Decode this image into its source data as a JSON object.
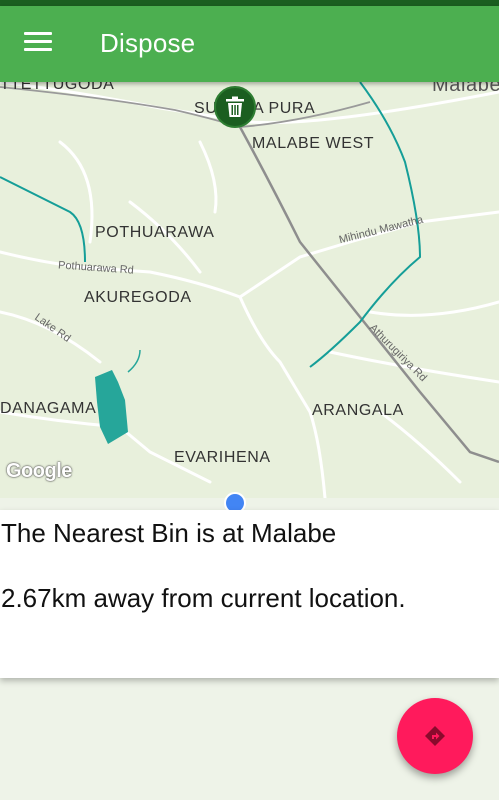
{
  "app": {
    "title": "Dispose",
    "menu_icon": "hamburger-menu-icon",
    "theme": {
      "appbar": "#4caf50",
      "statusbar": "#1b5e20",
      "fab": "#ff1a5c"
    }
  },
  "map": {
    "places": [
      "TTETTUGODA",
      "SUDANA PURA",
      "MALABE WEST",
      "Malabe",
      "POTHUARAWA",
      "AKUREGODA",
      "DANAGAMA",
      "ARANGALA",
      "EVARIHENA"
    ],
    "roads": [
      "Mihindu Mawatha",
      "Pothuarawa Rd",
      "Lake Rd",
      "Athurugiriya Rd"
    ],
    "attribution": "Google",
    "marker_icon": "trash-bin-icon"
  },
  "info": {
    "nearest": "The Nearest Bin is at Malabe",
    "distance": "2.67km away from current location."
  },
  "fab": {
    "icon": "directions-icon"
  }
}
